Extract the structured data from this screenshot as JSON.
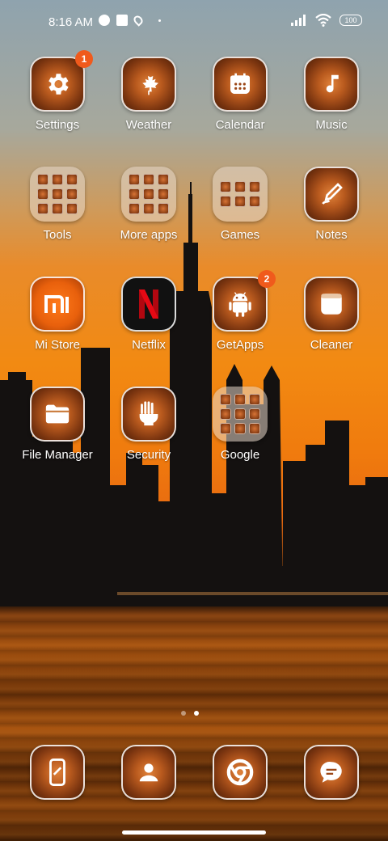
{
  "status": {
    "time": "8:16 AM",
    "battery": "100"
  },
  "apps": [
    {
      "label": "Settings",
      "badge": "1",
      "icon": "gear-icon"
    },
    {
      "label": "Weather",
      "icon": "maple-leaf-icon"
    },
    {
      "label": "Calendar",
      "icon": "calendar-icon"
    },
    {
      "label": "Music",
      "icon": "music-note-icon"
    },
    {
      "label": "Tools",
      "folder": true
    },
    {
      "label": "More apps",
      "folder": true
    },
    {
      "label": "Games",
      "folder": true
    },
    {
      "label": "Notes",
      "icon": "pen-icon"
    },
    {
      "label": "Mi Store",
      "icon": "mi-logo-icon"
    },
    {
      "label": "Netflix",
      "icon": "netflix-logo-icon"
    },
    {
      "label": "GetApps",
      "badge": "2",
      "icon": "android-icon"
    },
    {
      "label": "Cleaner",
      "icon": "cleaner-icon"
    },
    {
      "label": "File Manager",
      "icon": "folder-icon"
    },
    {
      "label": "Security",
      "icon": "shield-hand-icon"
    },
    {
      "label": "Google",
      "folder": true
    }
  ],
  "dock": [
    {
      "icon": "phone-icon"
    },
    {
      "icon": "contacts-icon"
    },
    {
      "icon": "chrome-icon"
    },
    {
      "icon": "messages-icon"
    }
  ],
  "pages": {
    "count": 2,
    "current": 2
  },
  "colors": {
    "badge": "#f05a1c",
    "accent": "#f28a12"
  }
}
